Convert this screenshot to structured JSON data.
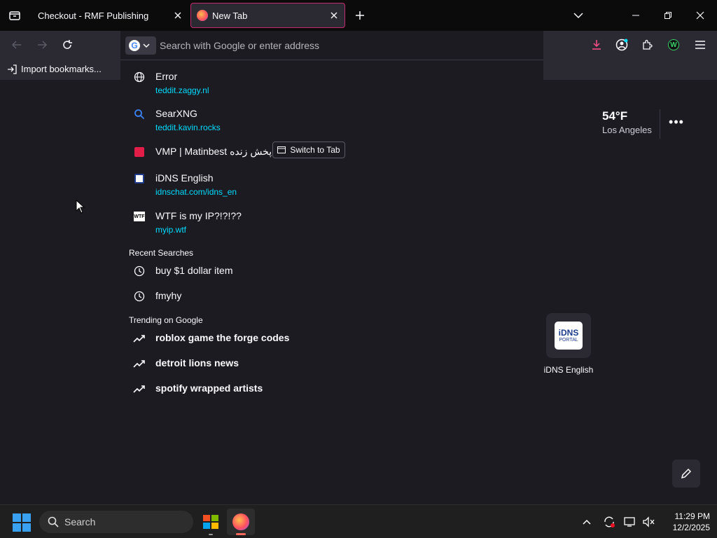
{
  "tabs": [
    {
      "title": "Checkout - RMF Publishing",
      "active": false
    },
    {
      "title": "New Tab",
      "active": true
    }
  ],
  "urlbar": {
    "placeholder": "Search with Google or enter address"
  },
  "bookmarks": {
    "import_label": "Import bookmarks..."
  },
  "suggestions": [
    {
      "title": "Error",
      "url": "teddit.zaggy.nl",
      "icon": "globe-icon"
    },
    {
      "title": "SearXNG",
      "url": "teddit.kavin.rocks",
      "icon": "search-icon"
    },
    {
      "title": "VMP | Matinbest پخش زنده",
      "action": "Switch to Tab",
      "icon": "site-favicon"
    },
    {
      "title": "iDNS English",
      "url": "idnschat.com/idns_en",
      "icon": "site-favicon"
    },
    {
      "title": "WTF is my IP?!?!??",
      "url": "myip.wtf",
      "icon": "site-favicon"
    }
  ],
  "recent": {
    "heading": "Recent Searches",
    "items": [
      "buy $1 dollar item",
      "fmyhy"
    ]
  },
  "trending": {
    "heading": "Trending on Google",
    "items": [
      "roblox game the forge codes",
      "detroit lions news",
      "spotify wrapped artists"
    ]
  },
  "weather": {
    "temp": "54°F",
    "location": "Los Angeles"
  },
  "shortcut": {
    "label": "iDNS English",
    "logo_top": "iDNS",
    "logo_bottom": "PORTAL"
  },
  "taskbar": {
    "search_label": "Search",
    "time": "11:29 PM",
    "date": "12/2/2025"
  },
  "colors": {
    "accent": "#c3296e",
    "link": "#00ddff",
    "windows_blue": "#3aa0f0"
  }
}
